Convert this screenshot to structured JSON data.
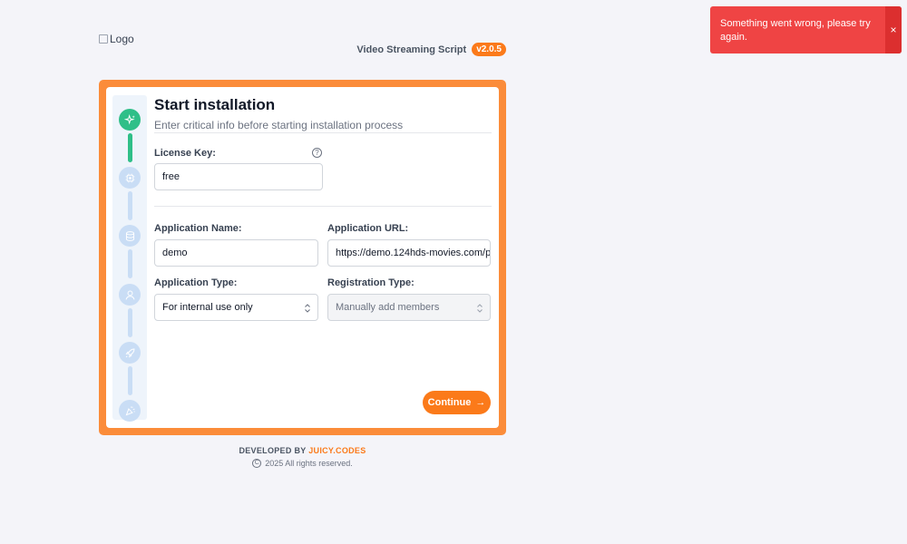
{
  "header": {
    "logo_alt": "Logo",
    "product_name": "Video Streaming Script",
    "version": "v2.0.5"
  },
  "install": {
    "title": "Start installation",
    "subtitle": "Enter critical info before starting installation process",
    "license_label": "License Key:",
    "license_value": "free",
    "app_name_label": "Application Name:",
    "app_name_value": "demo",
    "app_url_label": "Application URL:",
    "app_url_value": "https://demo.124hds-movies.com/p",
    "app_type_label": "Application Type:",
    "app_type_value": "For internal use only",
    "reg_type_label": "Registration Type:",
    "reg_type_value": "Manually add members",
    "continue_label": "Continue",
    "continue_arrow": "→"
  },
  "stepper": {
    "steps": [
      {
        "icon": "sparkles-icon",
        "state": "active"
      },
      {
        "icon": "cpu-icon",
        "state": "pending"
      },
      {
        "icon": "database-icon",
        "state": "pending"
      },
      {
        "icon": "user-icon",
        "state": "pending"
      },
      {
        "icon": "rocket-icon",
        "state": "pending"
      },
      {
        "icon": "party-popper-icon",
        "state": "pending"
      }
    ],
    "active_color": "#2fbf88",
    "pending_color": "#c9ddf5"
  },
  "footer": {
    "developed_by": "DEVELOPED BY",
    "brand": "JUICY.CODES",
    "copyright_symbol": "C",
    "copyright": "2025 All rights reserved."
  },
  "toast": {
    "message": "Something went wrong, please try again.",
    "close": "×"
  },
  "colors": {
    "accent": "#fb7a1a",
    "error": "#ef4444"
  }
}
